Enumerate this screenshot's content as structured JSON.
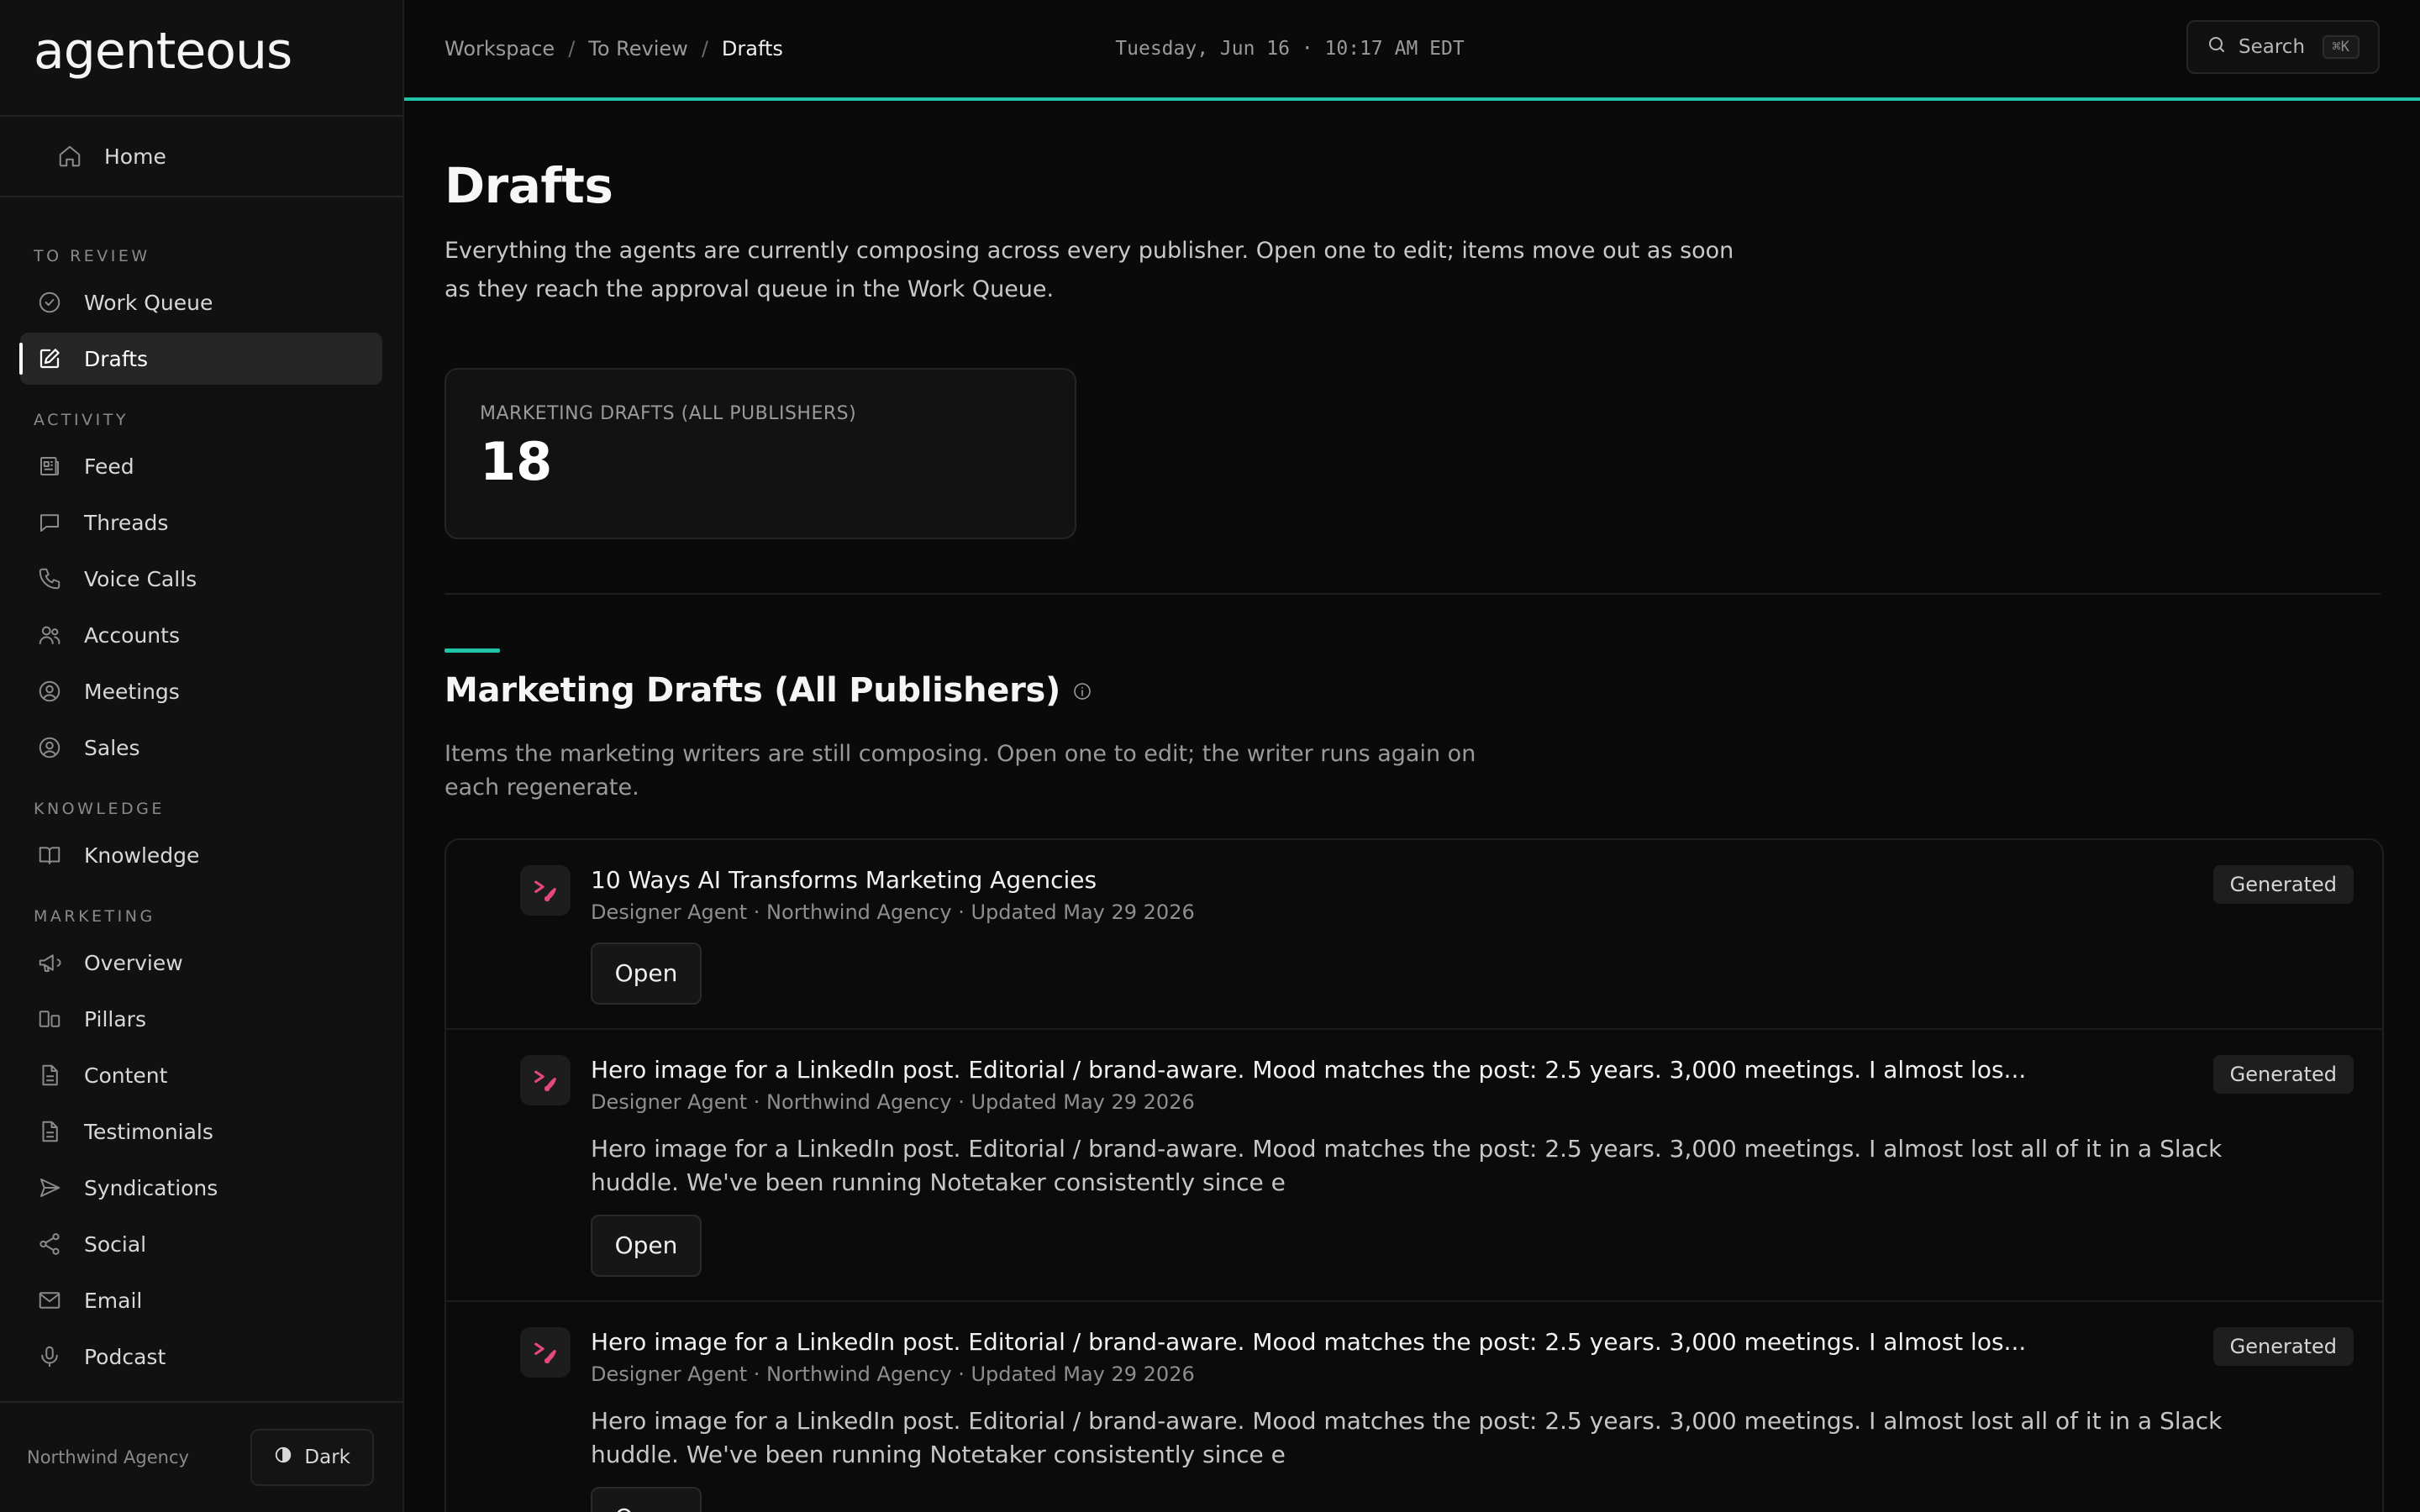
{
  "app": {
    "logo_text": "agenteous"
  },
  "sidebar": {
    "home": "Home",
    "sections": [
      {
        "label": "TO REVIEW",
        "items": [
          {
            "label": "Work Queue",
            "icon": "check-circle-icon"
          },
          {
            "label": "Drafts",
            "icon": "edit-icon",
            "active": true
          }
        ]
      },
      {
        "label": "ACTIVITY",
        "items": [
          {
            "label": "Feed",
            "icon": "newspaper-icon"
          },
          {
            "label": "Threads",
            "icon": "chat-bubble-icon"
          },
          {
            "label": "Voice Calls",
            "icon": "phone-icon"
          },
          {
            "label": "Accounts",
            "icon": "users-icon"
          },
          {
            "label": "Meetings",
            "icon": "user-circle-icon"
          },
          {
            "label": "Sales",
            "icon": "user-circle-icon"
          }
        ]
      },
      {
        "label": "KNOWLEDGE",
        "items": [
          {
            "label": "Knowledge",
            "icon": "book-icon"
          }
        ]
      },
      {
        "label": "MARKETING",
        "items": [
          {
            "label": "Overview",
            "icon": "megaphone-icon"
          },
          {
            "label": "Pillars",
            "icon": "columns-icon"
          },
          {
            "label": "Content",
            "icon": "document-icon"
          },
          {
            "label": "Testimonials",
            "icon": "document-icon"
          },
          {
            "label": "Syndications",
            "icon": "send-icon"
          },
          {
            "label": "Social",
            "icon": "share-icon"
          },
          {
            "label": "Email",
            "icon": "mail-icon"
          },
          {
            "label": "Podcast",
            "icon": "mic-icon"
          }
        ]
      }
    ],
    "footer": {
      "org": "Northwind Agency",
      "theme_label": "Dark"
    }
  },
  "topbar": {
    "breadcrumb": [
      "Workspace",
      "To Review",
      "Drafts"
    ],
    "datetime": "Tuesday, Jun 16 · 10:17 AM EDT",
    "search_label": "Search",
    "search_shortcut": "⌘K"
  },
  "page": {
    "title": "Drafts",
    "description": "Everything the agents are currently composing across every publisher. Open one to edit; items move out as soon as they reach the approval queue in the Work Queue.",
    "stat": {
      "label": "MARKETING DRAFTS (ALL PUBLISHERS)",
      "value": "18"
    }
  },
  "section": {
    "title": "Marketing Drafts (All Publishers)",
    "description": "Items the marketing writers are still composing. Open one to edit; the writer runs again on each regenerate."
  },
  "drafts": [
    {
      "title": "10 Ways AI Transforms Marketing Agencies",
      "meta": "Designer Agent · Northwind Agency · Updated May 29 2026",
      "body": "",
      "status": "Generated",
      "open_label": "Open"
    },
    {
      "title": "Hero image for a LinkedIn post. Editorial / brand-aware. Mood matches the post: 2.5 years. 3,000 meetings. I almost los...",
      "meta": "Designer Agent · Northwind Agency · Updated May 29 2026",
      "body": "Hero image for a LinkedIn post. Editorial / brand-aware. Mood matches the post: 2.5 years. 3,000 meetings. I almost lost all of it in a Slack huddle. We've been running Notetaker consistently since e",
      "status": "Generated",
      "open_label": "Open"
    },
    {
      "title": "Hero image for a LinkedIn post. Editorial / brand-aware. Mood matches the post: 2.5 years. 3,000 meetings. I almost los...",
      "meta": "Designer Agent · Northwind Agency · Updated May 29 2026",
      "body": "Hero image for a LinkedIn post. Editorial / brand-aware. Mood matches the post: 2.5 years. 3,000 meetings. I almost lost all of it in a Slack huddle. We've been running Notetaker consistently since e",
      "status": "Generated",
      "open_label": "Open"
    }
  ],
  "colors": {
    "background": "#0a0a0a",
    "sidebar": "#111111",
    "accent": "#1fc4a8",
    "agent_icon": "#e5487a"
  }
}
